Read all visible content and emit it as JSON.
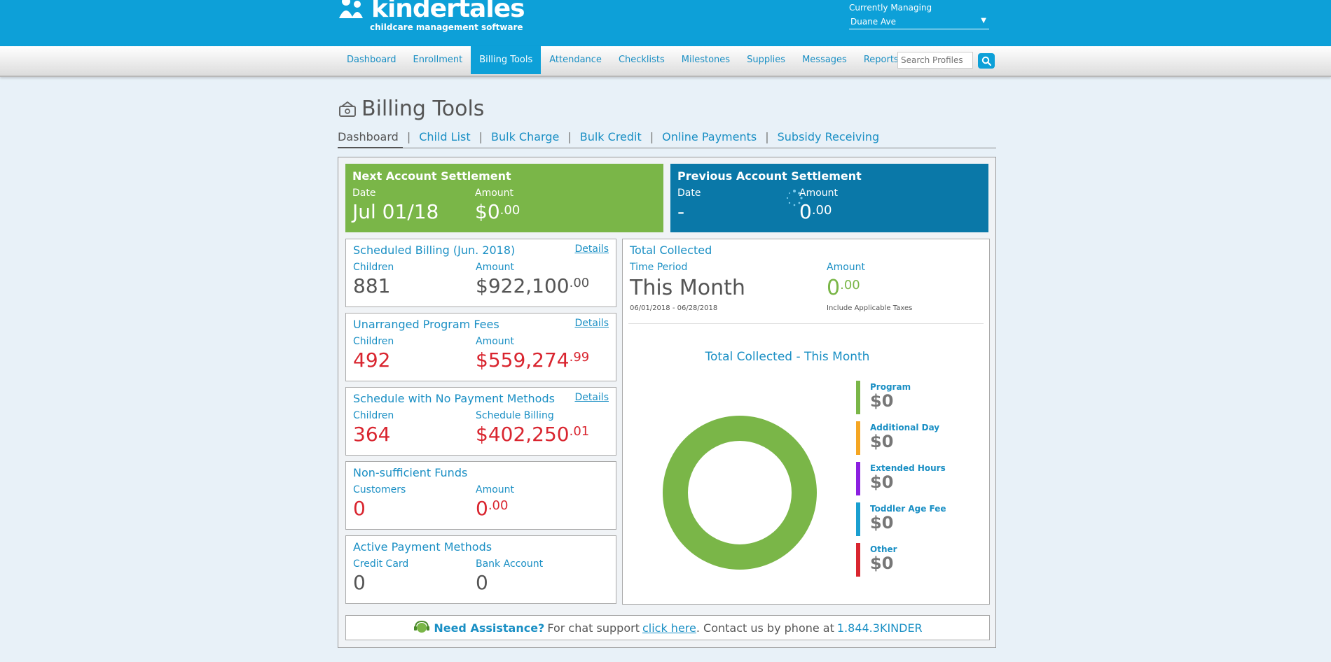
{
  "brand": {
    "logo_text": "kindertales",
    "tagline": "childcare management software"
  },
  "manage": {
    "label": "Currently Managing",
    "selected": "Duane Ave"
  },
  "nav": {
    "items": [
      "Dashboard",
      "Enrollment",
      "Billing Tools",
      "Attendance",
      "Checklists",
      "Milestones",
      "Supplies",
      "Messages",
      "Reports"
    ],
    "active": "Billing Tools",
    "search_placeholder": "Search Profiles"
  },
  "page": {
    "title": "Billing Tools",
    "subnav": [
      "Dashboard",
      "Child List",
      "Bulk Charge",
      "Bulk Credit",
      "Online Payments",
      "Subsidy Receiving"
    ]
  },
  "next_settlement": {
    "title": "Next Account Settlement",
    "date_label": "Date",
    "date": "Jul 01/18",
    "amount_label": "Amount",
    "amount": "$0",
    "amount_cents": ".00"
  },
  "prev_settlement": {
    "title": "Previous Account Settlement",
    "date_label": "Date",
    "date": "-",
    "amount_label": "Amount",
    "amount": "0",
    "amount_cents": ".00"
  },
  "cards": {
    "scheduled": {
      "title": "Scheduled Billing (Jun. 2018)",
      "details": "Details",
      "l1": "Children",
      "v1": "881",
      "l2": "Amount",
      "v2": "$922,100",
      "v2c": ".00"
    },
    "unarranged": {
      "title": "Unarranged Program Fees",
      "details": "Details",
      "l1": "Children",
      "v1": "492",
      "l2": "Amount",
      "v2": "$559,274",
      "v2c": ".99"
    },
    "nopay": {
      "title": "Schedule with No Payment Methods",
      "details": "Details",
      "l1": "Children",
      "v1": "364",
      "l2": "Schedule Billing",
      "v2": "$402,250",
      "v2c": ".01"
    },
    "nsf": {
      "title": "Non-sufficient Funds",
      "l1": "Customers",
      "v1": "0",
      "l2": "Amount",
      "v2": "0",
      "v2c": ".00"
    },
    "active": {
      "title": "Active Payment Methods",
      "l1": "Credit Card",
      "v1": "0",
      "l2": "Bank Account",
      "v2": "0"
    }
  },
  "total": {
    "title": "Total Collected",
    "period_label": "Time Period",
    "period": "This Month",
    "range": "06/01/2018 - 06/28/2018",
    "amount_label": "Amount",
    "amount": "0",
    "amount_cents": ".00",
    "tax_note": "Include Applicable Taxes",
    "chart_title": "Total Collected - This Month",
    "legend": [
      {
        "name": "Program",
        "value": "$0",
        "color": "#7ab648"
      },
      {
        "name": "Additional Day",
        "value": "$0",
        "color": "#f5a623"
      },
      {
        "name": "Extended Hours",
        "value": "$0",
        "color": "#8b1fe0"
      },
      {
        "name": "Toddler Age Fee",
        "value": "$0",
        "color": "#1a9fd0"
      },
      {
        "name": "Other",
        "value": "$0",
        "color": "#d9252f"
      }
    ]
  },
  "assist": {
    "heading": "Need Assistance?",
    "text1": "For chat support",
    "link": "click here",
    "text2": ". Contact us by phone at",
    "phone": "1.844.3KINDER"
  }
}
